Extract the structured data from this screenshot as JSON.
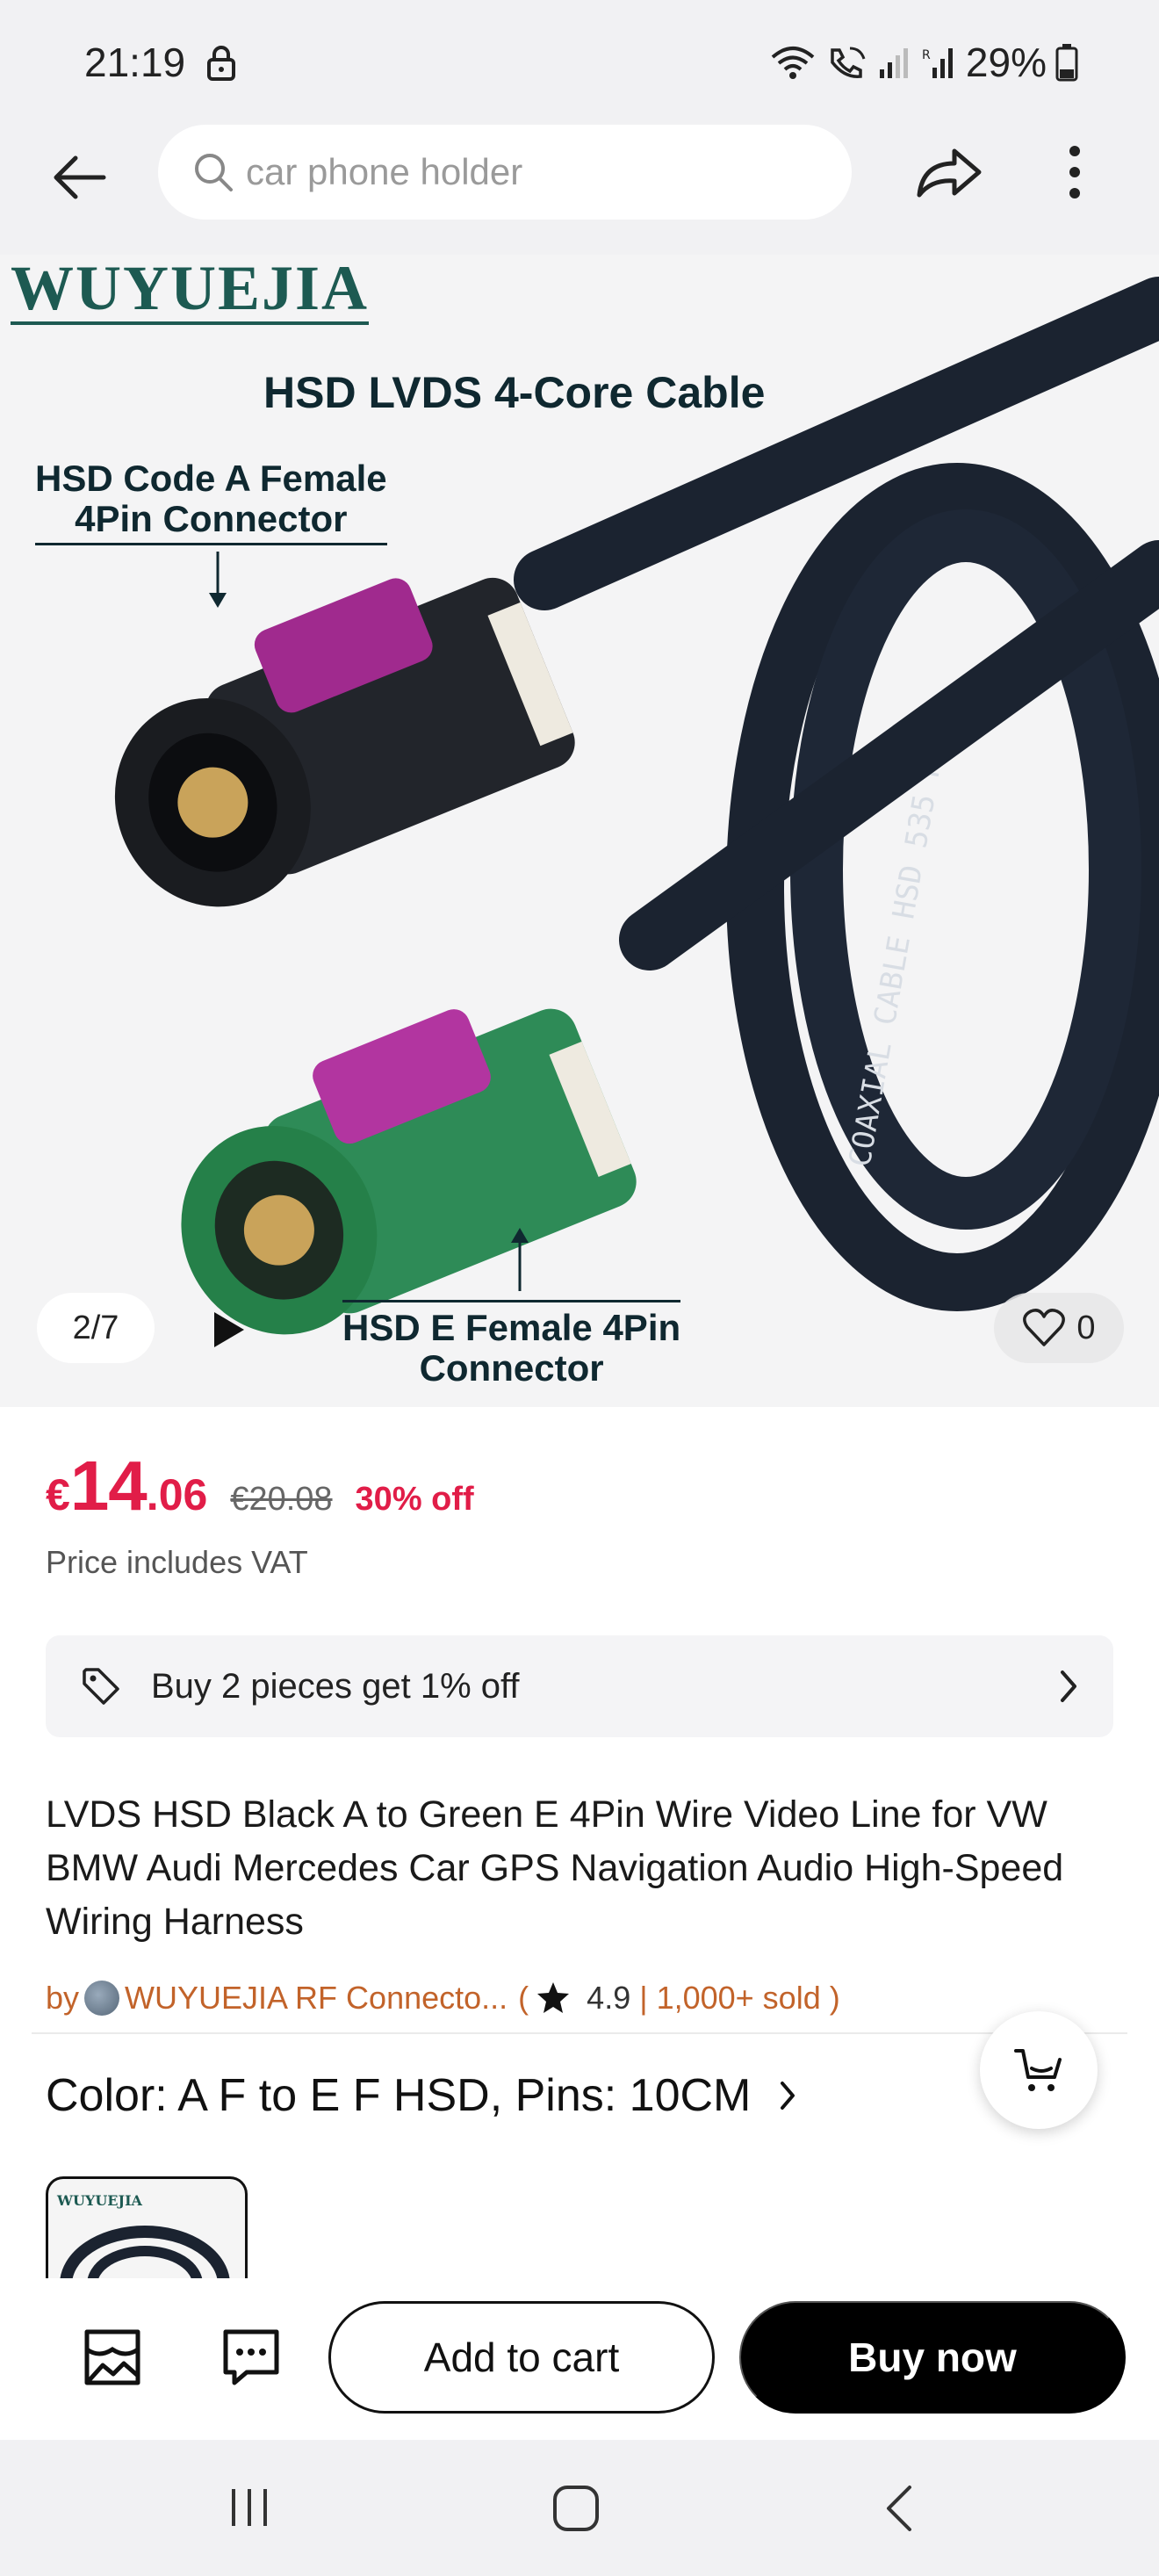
{
  "status_bar": {
    "time": "21:19",
    "battery": "29%",
    "icons": [
      "lock-icon",
      "wifi-icon",
      "wifi-calling-icon",
      "signal-icon",
      "roaming-signal-icon",
      "battery-icon"
    ]
  },
  "header": {
    "search_placeholder": "car phone holder",
    "icons": [
      "back-arrow-icon",
      "search-icon",
      "share-icon",
      "more-vertical-icon"
    ]
  },
  "gallery": {
    "brand": "WUYUEJIA",
    "image_title": "HSD LVDS 4-Core Cable",
    "label_a": "HSD Code A Female\n4Pin Connector",
    "label_e": "HSD E Female 4Pin\nConnector",
    "counter": "2/7",
    "wishlist_count": "0"
  },
  "price": {
    "currency": "€",
    "integer": "14",
    "decimal": ".06",
    "original": "€20.08",
    "discount": "30% off",
    "vat_note": "Price includes VAT"
  },
  "promo": {
    "text": "Buy 2 pieces get 1% off"
  },
  "product": {
    "title": "LVDS HSD Black A to Green E 4Pin Wire Video Line for VW BMW Audi Mercedes Car GPS Navigation Audio High-Speed Wiring Harness",
    "seller_prefix": "by",
    "seller_name": "WUYUEJIA RF Connecto...",
    "paren_open": "(",
    "rating": "4.9",
    "sold": "| 1,000+ sold )",
    "variant": "Color: A F to E F HSD, Pins: 10CM"
  },
  "actions": {
    "add_to_cart": "Add to cart",
    "buy_now": "Buy now"
  },
  "colors": {
    "price_red": "#e11d48",
    "seller_orange": "#c2632a",
    "connector_green": "#2e8b57",
    "connector_purple": "#a02a8e"
  }
}
